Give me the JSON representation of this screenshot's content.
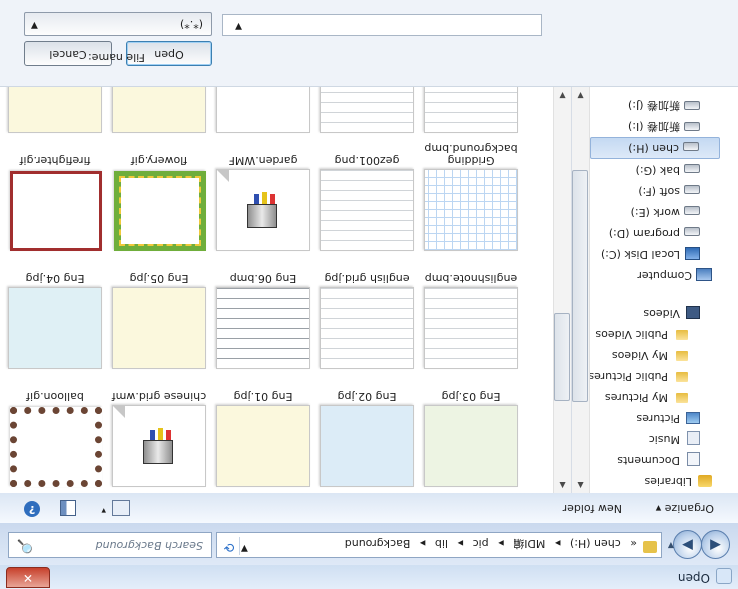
{
  "window": {
    "title": "Open",
    "close_glyph": "✕"
  },
  "nav_buttons": {
    "back": "◀",
    "forward": "▶",
    "recent": "▼"
  },
  "address": {
    "segments": [
      "«",
      "chen (H:)",
      "▸",
      "MDI编",
      "▸",
      "pic",
      "▸",
      "lib",
      "▸",
      "Background"
    ],
    "dropdown": "▼",
    "refresh": "⟳"
  },
  "search": {
    "placeholder": "Search Background",
    "icon": "🔍"
  },
  "toolbar": {
    "organize": "Organize ▾",
    "new_folder": "New folder",
    "view_arrow": "▾",
    "help": "?"
  },
  "nav_pane": {
    "items": [
      {
        "label": "Libraries",
        "icon": "lib"
      },
      {
        "label": "Documents",
        "icon": "doc"
      },
      {
        "label": "Music",
        "icon": "music"
      },
      {
        "label": "Pictures",
        "icon": "pic"
      },
      {
        "label": "My Pictures",
        "icon": "folder"
      },
      {
        "label": "Public Pictures",
        "icon": "folder"
      },
      {
        "label": "My Videos",
        "icon": "folder"
      },
      {
        "label": "Public Videos",
        "icon": "folder"
      },
      {
        "label": "Videos",
        "icon": "vid"
      },
      {
        "label": "Computer",
        "icon": "comp"
      },
      {
        "label": "Local Disk (C:)",
        "icon": "windrive"
      },
      {
        "label": "program (D:)",
        "icon": "drive"
      },
      {
        "label": "work (E:)",
        "icon": "drive"
      },
      {
        "label": "soft (F:)",
        "icon": "drive"
      },
      {
        "label": "bak (G:)",
        "icon": "drive"
      },
      {
        "label": "chen (H:)",
        "icon": "drive",
        "selected": true
      },
      {
        "label": "新加卷 (I:)",
        "icon": "drive"
      },
      {
        "label": "新加卷 (J:)",
        "icon": "drive"
      }
    ],
    "scroll_up": "▲",
    "scroll_down": "▼"
  },
  "files": {
    "row1": [
      {
        "name": "balloon.gif",
        "style": "frame-dots"
      },
      {
        "name": "chinese grid.wmf",
        "style": "wmf"
      },
      {
        "name": "Eng 01.jpg",
        "style": "lightyellow"
      },
      {
        "name": "Eng 02.jpg",
        "style": "paleblue"
      },
      {
        "name": "Eng 03.jpg",
        "style": "palegreen"
      }
    ],
    "row2": [
      {
        "name": "Eng 04.jpg",
        "style": "lightblue"
      },
      {
        "name": "Eng 05.jpg",
        "style": "lightyellow"
      },
      {
        "name": "Eng 06.bmp",
        "style": "ruled"
      },
      {
        "name": "english grid.jpg",
        "style": "ruledlight"
      },
      {
        "name": "englishnote.bmp",
        "style": "ruledlight"
      }
    ],
    "row3": [
      {
        "name": "firefighter.gif",
        "style": "frame-red"
      },
      {
        "name": "flowery.gif",
        "style": "frame-floral"
      },
      {
        "name": "garden.WMF",
        "style": "wmf"
      },
      {
        "name": "gez001.png",
        "style": "ruledlight"
      },
      {
        "name": "Gridding",
        "name2": "background.bmp",
        "style": "grid"
      }
    ],
    "scroll_up": "▲",
    "scroll_down": "▼",
    "grip": "≡"
  },
  "bottom": {
    "file_name_label": "File name:",
    "file_name_value": "",
    "file_type": "(*.*)",
    "open_label": "Open",
    "cancel_label": "Cancel"
  }
}
